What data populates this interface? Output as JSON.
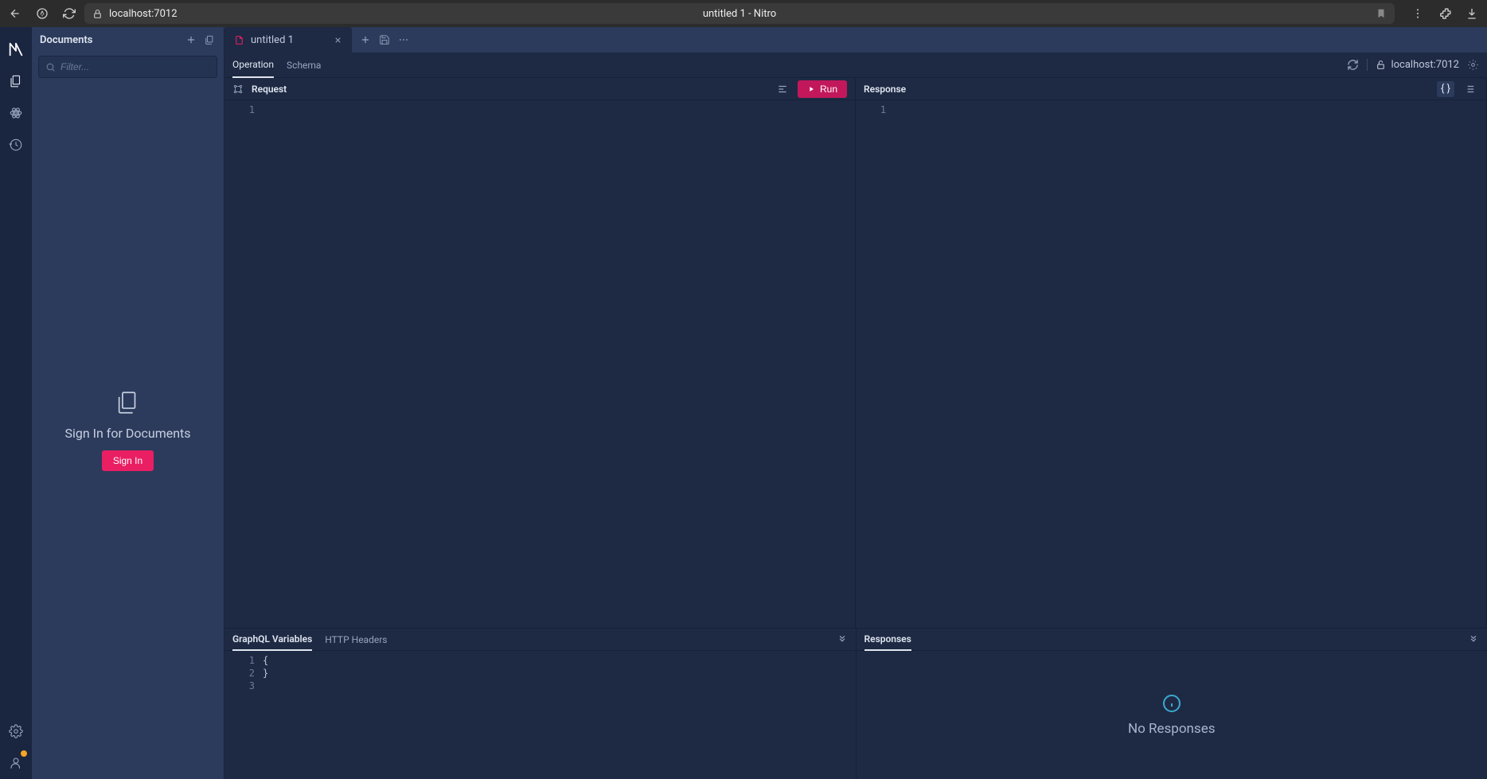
{
  "browser": {
    "url": "localhost:7012",
    "title": "untitled 1 - Nitro"
  },
  "sidebar": {
    "title": "Documents",
    "filter_placeholder": "Filter...",
    "empty_title": "Sign In for Documents",
    "signin_label": "Sign In"
  },
  "tabs": {
    "items": [
      {
        "label": "untitled 1"
      }
    ]
  },
  "subnav": {
    "operation_label": "Operation",
    "schema_label": "Schema",
    "endpoint": "localhost:7012"
  },
  "request": {
    "header": "Request",
    "run_label": "Run",
    "line_numbers": [
      "1"
    ]
  },
  "response": {
    "header": "Response",
    "line_numbers": [
      "1"
    ]
  },
  "variables": {
    "tab_graphql": "GraphQL Variables",
    "tab_headers": "HTTP Headers",
    "line_numbers": [
      "1",
      "2",
      "3"
    ],
    "lines": [
      "{",
      "",
      "}"
    ]
  },
  "responses_panel": {
    "title": "Responses",
    "empty_message": "No Responses"
  }
}
